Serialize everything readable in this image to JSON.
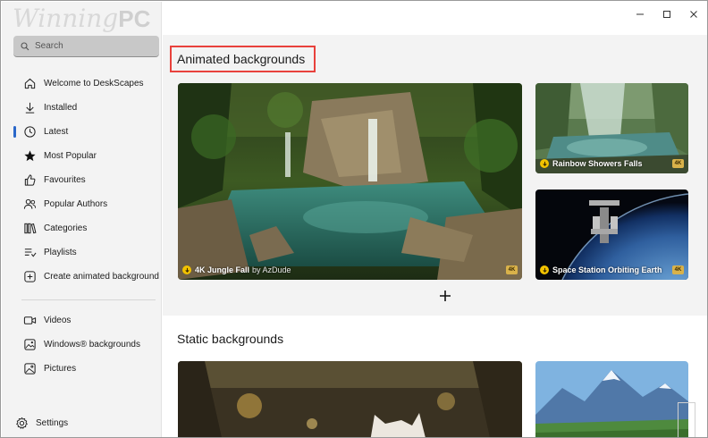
{
  "app": {
    "watermark_main": "Winning",
    "watermark_suffix": "PC"
  },
  "search": {
    "placeholder": "Search"
  },
  "sidebar": {
    "items": [
      {
        "label": "Welcome to DeskScapes",
        "icon": "home-icon"
      },
      {
        "label": "Installed",
        "icon": "download-arrow-icon"
      },
      {
        "label": "Latest",
        "icon": "clock-icon",
        "active": true
      },
      {
        "label": "Most Popular",
        "icon": "star-icon"
      },
      {
        "label": "Favourites",
        "icon": "thumbs-up-icon"
      },
      {
        "label": "Popular Authors",
        "icon": "people-icon"
      },
      {
        "label": "Categories",
        "icon": "library-icon"
      },
      {
        "label": "Playlists",
        "icon": "playlist-icon"
      },
      {
        "label": "Create animated background",
        "icon": "add-square-icon"
      }
    ],
    "media_items": [
      {
        "label": "Videos",
        "icon": "video-icon"
      },
      {
        "label": "Windows® backgrounds",
        "icon": "windows-image-icon"
      },
      {
        "label": "Pictures",
        "icon": "picture-icon"
      }
    ],
    "settings_label": "Settings"
  },
  "main": {
    "animated_title": "Animated backgrounds",
    "static_title": "Static backgrounds",
    "animated_cards": [
      {
        "title": "4K Jungle Fall",
        "by": "by AzDude",
        "badge": "4K"
      },
      {
        "title": "Rainbow Showers Falls",
        "badge": "4K"
      },
      {
        "title": "Space Station Orbiting Earth",
        "badge": "4K"
      }
    ]
  },
  "colors": {
    "accent": "#2a67c9",
    "highlight": "#e8413c",
    "download_badge": "#f2c200"
  }
}
